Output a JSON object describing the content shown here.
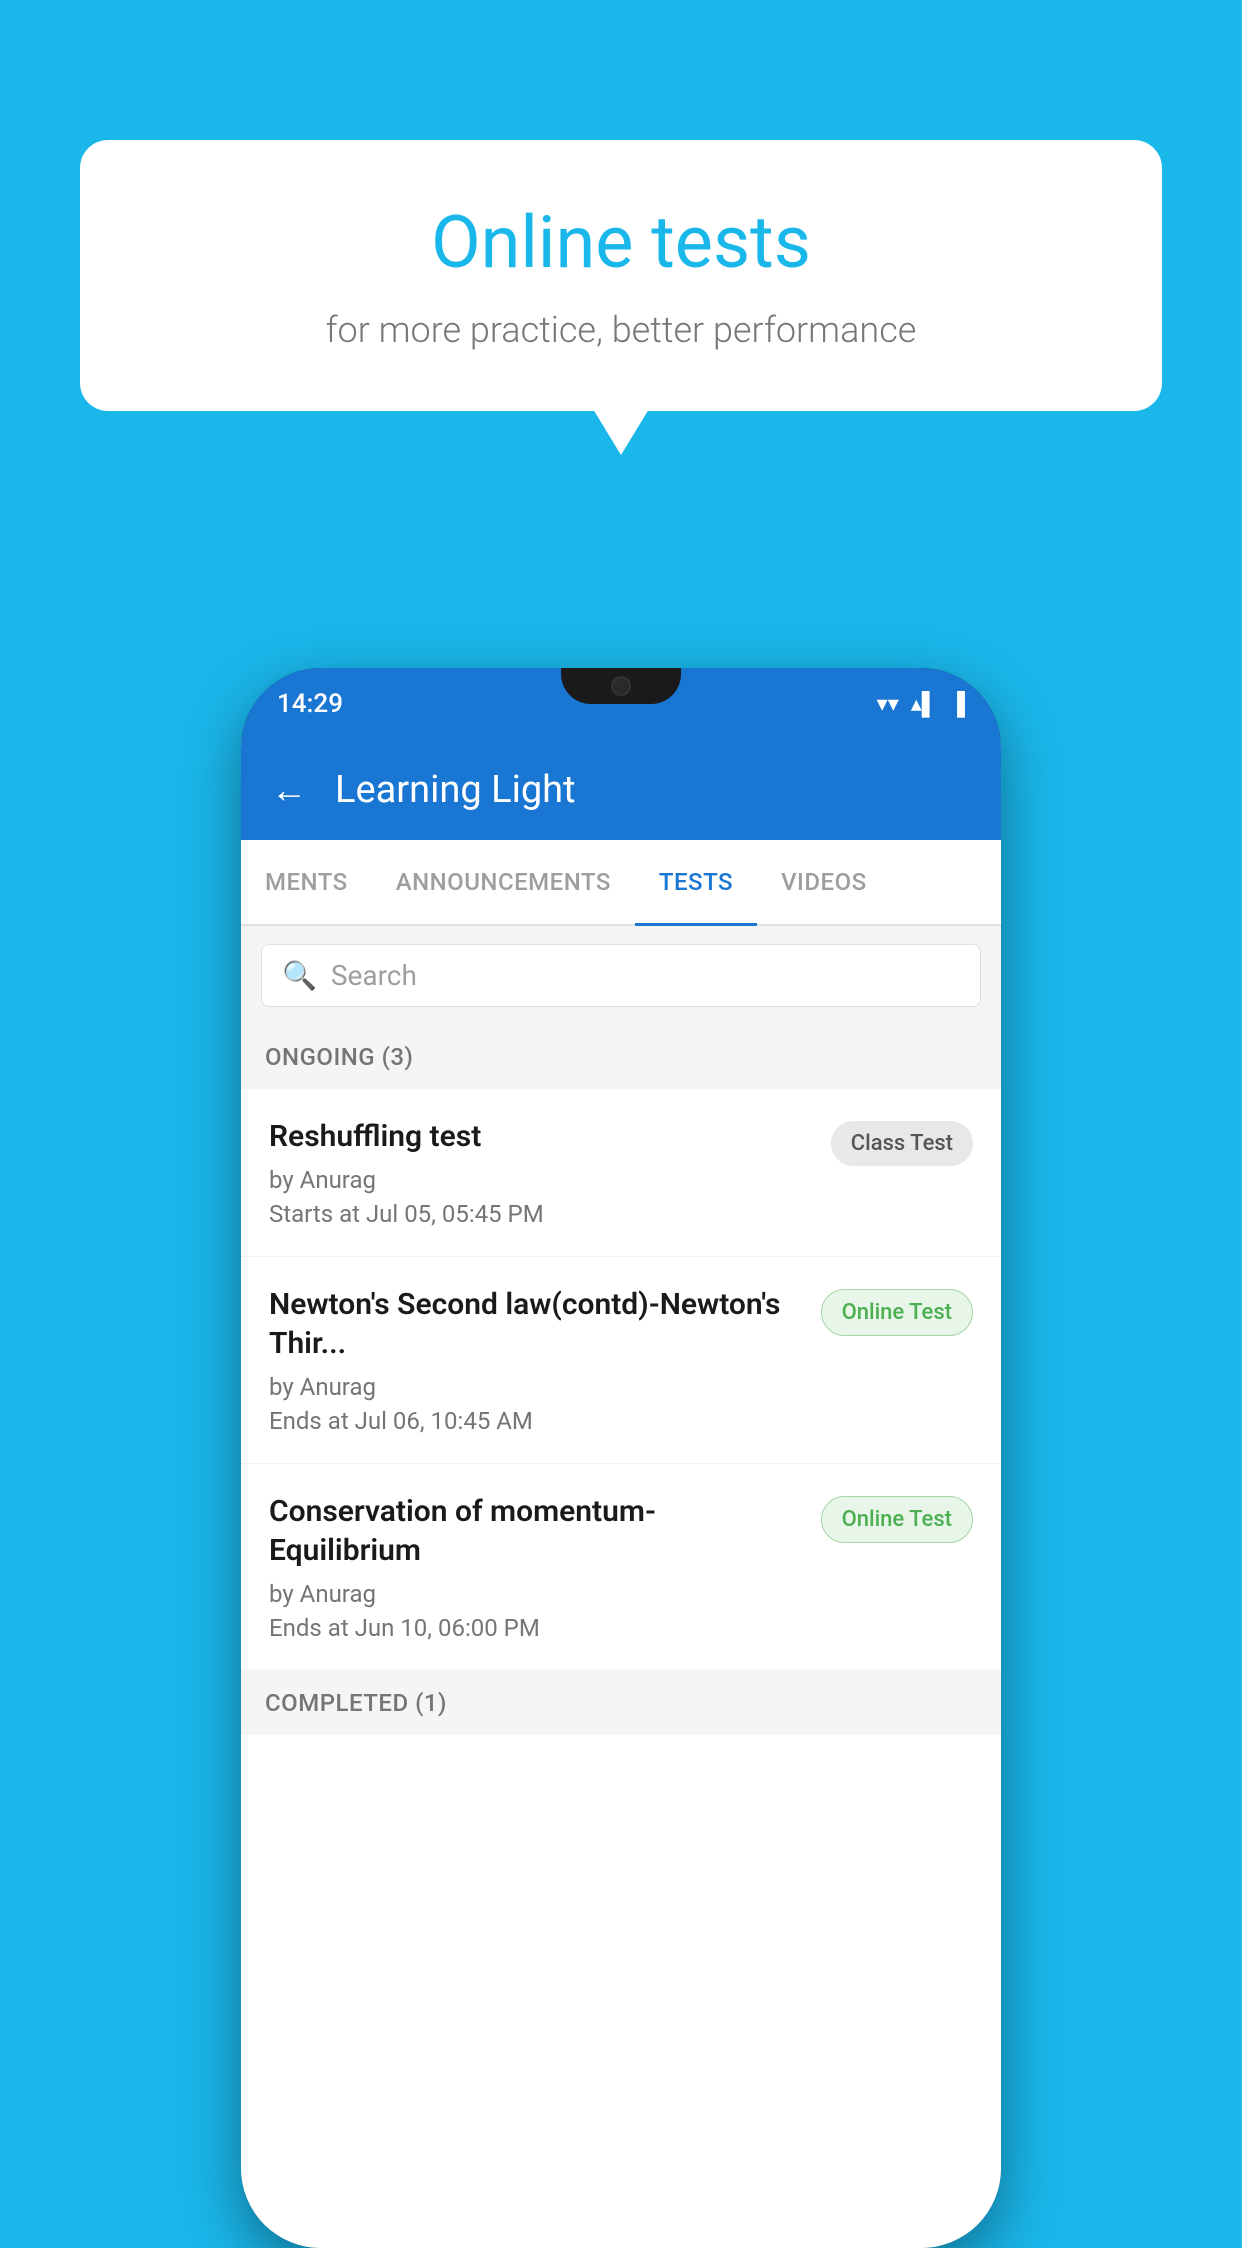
{
  "background_color": "#1ab7ea",
  "bubble": {
    "title": "Online tests",
    "subtitle": "for more practice, better performance"
  },
  "phone": {
    "status_bar": {
      "time": "14:29",
      "wifi_icon": "▼",
      "signal_icon": "▲",
      "battery_icon": "▌"
    },
    "app_bar": {
      "back_label": "←",
      "title": "Learning Light"
    },
    "tabs": [
      {
        "label": "MENTS",
        "active": false
      },
      {
        "label": "ANNOUNCEMENTS",
        "active": false
      },
      {
        "label": "TESTS",
        "active": true
      },
      {
        "label": "VIDEOS",
        "active": false
      }
    ],
    "search": {
      "placeholder": "Search"
    },
    "ongoing_section": {
      "header": "ONGOING (3)",
      "tests": [
        {
          "title": "Reshuffling test",
          "author": "by Anurag",
          "date": "Starts at  Jul 05, 05:45 PM",
          "badge": "Class Test",
          "badge_type": "class"
        },
        {
          "title": "Newton's Second law(contd)-Newton's Thir...",
          "author": "by Anurag",
          "date": "Ends at  Jul 06, 10:45 AM",
          "badge": "Online Test",
          "badge_type": "online"
        },
        {
          "title": "Conservation of momentum-Equilibrium",
          "author": "by Anurag",
          "date": "Ends at  Jun 10, 06:00 PM",
          "badge": "Online Test",
          "badge_type": "online"
        }
      ]
    },
    "completed_section": {
      "header": "COMPLETED (1)"
    }
  }
}
